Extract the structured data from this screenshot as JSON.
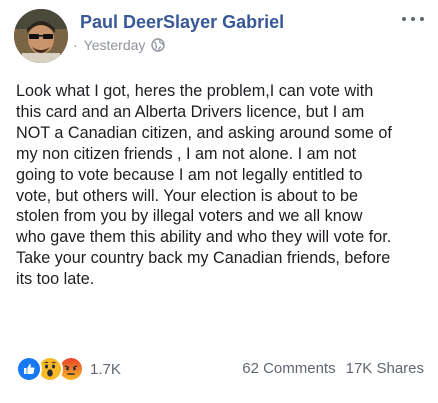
{
  "post": {
    "author": "Paul DeerSlayer Gabriel",
    "meta_dot": "·",
    "timestamp": "Yesterday",
    "privacy_icon": "globe-icon",
    "menu_icon": "more-options-icon",
    "body_lines": [
      "Look what I got, heres the problem,I can vote with",
      "this card and an Alberta Drivers licence, but I am",
      "NOT a Canadian citizen, and asking around some of",
      "my non citizen friends , I am not alone. I am not",
      "going to vote because I am not legally entitled to",
      "vote, but others will. Your election is about to be",
      "stolen from you by illegal voters and we all know",
      "who gave them this ability and who they will vote for.",
      "Take your country back my Canadian friends, before",
      "its too late."
    ]
  },
  "footer": {
    "reactions": [
      "like-reaction-icon",
      "wow-reaction-icon",
      "angry-reaction-icon"
    ],
    "reaction_count": "1.7K",
    "comments": "62 Comments",
    "shares": "17K Shares"
  },
  "colors": {
    "author": "#385898",
    "meta": "#90949c",
    "like": "#1877f2",
    "wow": "#f7b928",
    "angry": "#e9710f"
  }
}
